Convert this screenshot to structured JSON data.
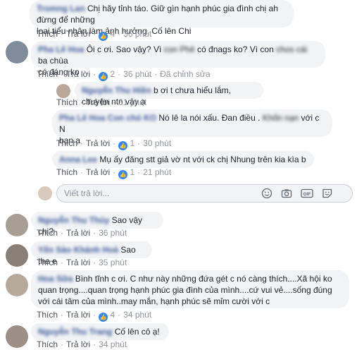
{
  "comments": [
    {
      "name": "Tromng Lan",
      "text_line1": "Chị hãy tỉnh táo. Giữ gìn hạnh phúc gia đình chị ah đừng để những",
      "text_line2": "loại tiểu nhân làm ảnh hưởng. Cố lên Chi",
      "actions": {
        "like": "Thích",
        "reply": "Trả lời",
        "likes": "4",
        "time": "36 phút"
      }
    },
    {
      "name": "Pha Lê Hoa",
      "text_a": "Ôi c ơi. Sao vậy? Vì",
      "text_blur1": "con Phê",
      "text_b": "có đnags ko? Vì con",
      "text_blur2": "chos cái",
      "text_c": "ba chùa",
      "text_line2": "có đáng ko",
      "actions": {
        "like": "Thích",
        "reply": "Trả lời",
        "likes": "2",
        "time": "36 phút",
        "edited": "Đã chỉnh sửa"
      }
    }
  ],
  "replies": [
    {
      "name": "Nguyễn Thu Hiền",
      "text": "b ơi t chưa hiểu lắm, chuyện ntn vậy ạ",
      "actions": {
        "like": "Thích",
        "reply": "Trả lời",
        "time": "31 phút"
      }
    },
    {
      "name": "Pha Lê Hoa Con chó KO",
      "text_a": "Nó lê la nói xấu. Đan điều .",
      "text_blur": "Khốn nạn",
      "text_b": "với c N",
      "text_line2": "bạn ạ",
      "actions": {
        "like": "Thích",
        "reply": "Trả lời",
        "likes": "1",
        "time": "30 phút"
      }
    },
    {
      "name": "Anna Lee",
      "text": "Mụ ấy đăng stt giả vờ nt với ck chị Nhung trên kia kìa b",
      "actions": {
        "like": "Thích",
        "reply": "Trả lời",
        "likes": "1",
        "time": "21 phút"
      }
    }
  ],
  "reply_box": {
    "placeholder": "Viết trả lời..."
  },
  "bottom_comments": [
    {
      "name": "Nguyễn Thu Thủy",
      "text": "Sao vậy chị?",
      "actions": {
        "like": "Thích",
        "reply": "Trả lời",
        "time": "36 phút"
      }
    },
    {
      "name": "Yến Sào Khánh Hoà",
      "text": "Sao the e",
      "actions": {
        "like": "Thích",
        "reply": "Trả lời",
        "time": "35 phút"
      }
    },
    {
      "name": "Hoa Sữa",
      "text_line1": "Bình tĩnh c ơi. C như này những đứa gét c nó càng thích....Xã hội ko",
      "text_line2": "quan trọng....quan trọng hạnh phúc gia đình của mình....cứ vui vẻ....sống đúng",
      "text_line3": "với cái tâm của mình..may mắn, hạnh phúc sẽ mỉm cười với c",
      "actions": {
        "like": "Thích",
        "reply": "Trả lời",
        "likes": "4",
        "time": "34 phút"
      }
    },
    {
      "name": "Nguyễn Thu Trang",
      "text": "Cố lên cô ạ!",
      "actions": {
        "like": "Thích",
        "reply": "Trả lời",
        "time": "34 phút"
      }
    }
  ],
  "colors": {
    "link": "#385898",
    "bubble": "#f2f3f5",
    "like": "#2d88ff",
    "meta": "#90949c"
  }
}
